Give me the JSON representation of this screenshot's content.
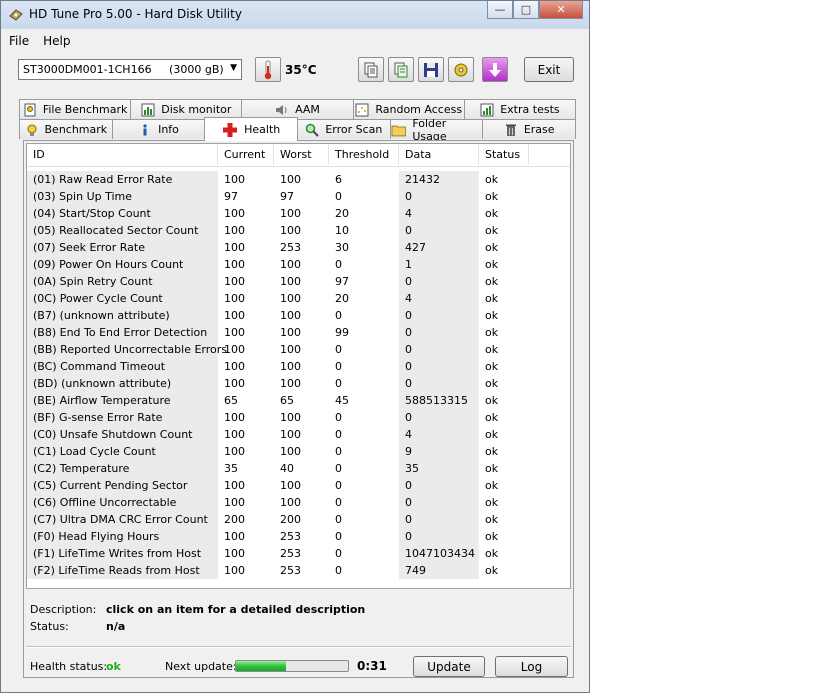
{
  "window": {
    "title": "HD Tune Pro 5.00 - Hard Disk Utility",
    "min_glyph": "—",
    "max_glyph": "□",
    "close_glyph": "✕"
  },
  "menu": {
    "items": [
      "File",
      "Help"
    ]
  },
  "toolbar": {
    "drive": "ST3000DM001-1CH166     (3000 gB)",
    "temperature": "35°C",
    "exit_label": "Exit"
  },
  "tabs": {
    "row1": [
      {
        "label": "File Benchmark",
        "icon": "file-benchmark-icon"
      },
      {
        "label": "Disk monitor",
        "icon": "disk-monitor-icon"
      },
      {
        "label": "AAM",
        "icon": "speaker-icon"
      },
      {
        "label": "Random Access",
        "icon": "random-access-icon"
      },
      {
        "label": "Extra tests",
        "icon": "extra-tests-icon"
      }
    ],
    "row2": [
      {
        "label": "Benchmark",
        "icon": "benchmark-icon"
      },
      {
        "label": "Info",
        "icon": "info-icon"
      },
      {
        "label": "Health",
        "icon": "health-cross-icon"
      },
      {
        "label": "Error Scan",
        "icon": "magnifier-icon"
      },
      {
        "label": "Folder Usage",
        "icon": "folder-icon"
      },
      {
        "label": "Erase",
        "icon": "trash-icon"
      }
    ],
    "active": "Health"
  },
  "table": {
    "columns": [
      "ID",
      "Current",
      "Worst",
      "Threshold",
      "Data",
      "Status"
    ],
    "rows": [
      [
        "(01) Raw Read Error Rate",
        "100",
        "100",
        "6",
        "21432",
        "ok"
      ],
      [
        "(03) Spin Up Time",
        "97",
        "97",
        "0",
        "0",
        "ok"
      ],
      [
        "(04) Start/Stop Count",
        "100",
        "100",
        "20",
        "4",
        "ok"
      ],
      [
        "(05) Reallocated Sector Count",
        "100",
        "100",
        "10",
        "0",
        "ok"
      ],
      [
        "(07) Seek Error Rate",
        "100",
        "253",
        "30",
        "427",
        "ok"
      ],
      [
        "(09) Power On Hours Count",
        "100",
        "100",
        "0",
        "1",
        "ok"
      ],
      [
        "(0A) Spin Retry Count",
        "100",
        "100",
        "97",
        "0",
        "ok"
      ],
      [
        "(0C) Power Cycle Count",
        "100",
        "100",
        "20",
        "4",
        "ok"
      ],
      [
        "(B7) (unknown attribute)",
        "100",
        "100",
        "0",
        "0",
        "ok"
      ],
      [
        "(B8) End To End Error Detection",
        "100",
        "100",
        "99",
        "0",
        "ok"
      ],
      [
        "(BB) Reported Uncorrectable Errors",
        "100",
        "100",
        "0",
        "0",
        "ok"
      ],
      [
        "(BC) Command Timeout",
        "100",
        "100",
        "0",
        "0",
        "ok"
      ],
      [
        "(BD) (unknown attribute)",
        "100",
        "100",
        "0",
        "0",
        "ok"
      ],
      [
        "(BE) Airflow Temperature",
        "65",
        "65",
        "45",
        "588513315",
        "ok"
      ],
      [
        "(BF) G-sense Error Rate",
        "100",
        "100",
        "0",
        "0",
        "ok"
      ],
      [
        "(C0) Unsafe Shutdown Count",
        "100",
        "100",
        "0",
        "4",
        "ok"
      ],
      [
        "(C1) Load Cycle Count",
        "100",
        "100",
        "0",
        "9",
        "ok"
      ],
      [
        "(C2) Temperature",
        "35",
        "40",
        "0",
        "35",
        "ok"
      ],
      [
        "(C5) Current Pending Sector",
        "100",
        "100",
        "0",
        "0",
        "ok"
      ],
      [
        "(C6) Offline Uncorrectable",
        "100",
        "100",
        "0",
        "0",
        "ok"
      ],
      [
        "(C7) Ultra DMA CRC Error Count",
        "200",
        "200",
        "0",
        "0",
        "ok"
      ],
      [
        "(F0) Head Flying Hours",
        "100",
        "253",
        "0",
        "0",
        "ok"
      ],
      [
        "(F1) LifeTime Writes from Host",
        "100",
        "253",
        "0",
        "1047103434",
        "ok"
      ],
      [
        "(F2) LifeTime Reads from Host",
        "100",
        "253",
        "0",
        "749",
        "ok"
      ]
    ]
  },
  "details": {
    "description_label": "Description:",
    "description_value": "click on an item for a detailed description",
    "status_label": "Status:",
    "status_value": "n/a"
  },
  "footer": {
    "health_label": "Health status:",
    "health_value": "ok",
    "health_color": "#1fae1f",
    "next_update_label": "Next update:",
    "progress": 0.45,
    "countdown": "0:31",
    "update_label": "Update",
    "log_label": "Log"
  }
}
